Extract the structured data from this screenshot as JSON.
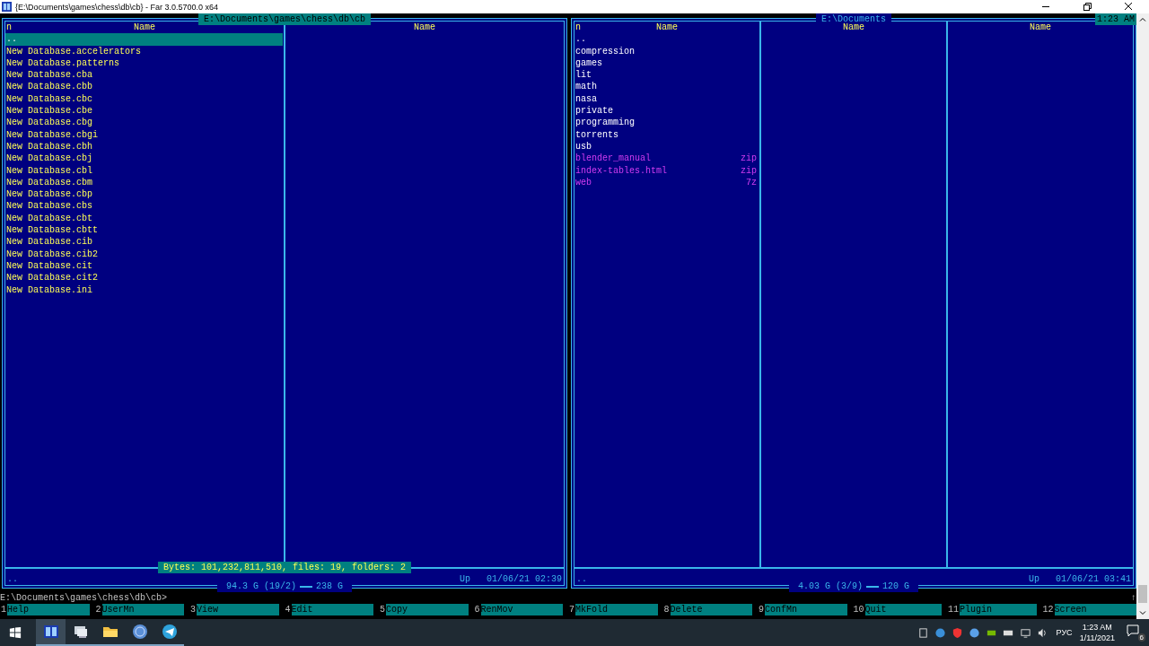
{
  "window": {
    "title": "{E:\\Documents\\games\\chess\\db\\cb} - Far 3.0.5700.0 x64"
  },
  "clock": "1:23 AM",
  "panels": [
    {
      "title": "E:\\Documents\\games\\chess\\db\\cb",
      "active": true,
      "sort_mark": "n",
      "column_headings": [
        "Name",
        "Name"
      ],
      "items": [
        {
          "name": "..",
          "kind": "up",
          "selected": true
        },
        {
          "name": "New Database.accelerators",
          "kind": "file",
          "selected": false
        },
        {
          "name": "New Database.patterns",
          "kind": "file",
          "selected": false
        },
        {
          "name": "New Database.cba",
          "kind": "file",
          "selected": false
        },
        {
          "name": "New Database.cbb",
          "kind": "file",
          "selected": false
        },
        {
          "name": "New Database.cbc",
          "kind": "file",
          "selected": false
        },
        {
          "name": "New Database.cbe",
          "kind": "file",
          "selected": false
        },
        {
          "name": "New Database.cbg",
          "kind": "file",
          "selected": false
        },
        {
          "name": "New Database.cbgi",
          "kind": "file",
          "selected": false
        },
        {
          "name": "New Database.cbh",
          "kind": "file",
          "selected": false
        },
        {
          "name": "New Database.cbj",
          "kind": "file",
          "selected": false
        },
        {
          "name": "New Database.cbl",
          "kind": "file",
          "selected": false
        },
        {
          "name": "New Database.cbm",
          "kind": "file",
          "selected": false
        },
        {
          "name": "New Database.cbp",
          "kind": "file",
          "selected": false
        },
        {
          "name": "New Database.cbs",
          "kind": "file",
          "selected": false
        },
        {
          "name": "New Database.cbt",
          "kind": "file",
          "selected": false
        },
        {
          "name": "New Database.cbtt",
          "kind": "file",
          "selected": false
        },
        {
          "name": "New Database.cib",
          "kind": "file",
          "selected": false
        },
        {
          "name": "New Database.cib2",
          "kind": "file",
          "selected": false
        },
        {
          "name": "New Database.cit",
          "kind": "file",
          "selected": false
        },
        {
          "name": "New Database.cit2",
          "kind": "file",
          "selected": false
        },
        {
          "name": "New Database.ini",
          "kind": "file",
          "selected": false
        }
      ],
      "selection_info": "Bytes: 101,232,811,510, files: 19, folders: 2",
      "status": {
        "name": "..",
        "info": "Up",
        "date": "01/06/21 02:39"
      },
      "totals": [
        "94.3 G (19/2)",
        "238 G"
      ]
    },
    {
      "title": "E:\\Documents",
      "active": false,
      "sort_mark": "n",
      "column_headings": [
        "Name",
        "Name",
        "Name"
      ],
      "items": [
        {
          "name": "..",
          "kind": "up",
          "selected": false
        },
        {
          "name": "compression",
          "kind": "folder",
          "selected": false
        },
        {
          "name": "games",
          "kind": "folder",
          "selected": false
        },
        {
          "name": "lit",
          "kind": "folder",
          "selected": false
        },
        {
          "name": "math",
          "kind": "folder",
          "selected": false
        },
        {
          "name": "nasa",
          "kind": "folder",
          "selected": false
        },
        {
          "name": "private",
          "kind": "folder",
          "selected": false
        },
        {
          "name": "programming",
          "kind": "folder",
          "selected": false
        },
        {
          "name": "torrents",
          "kind": "folder",
          "selected": false
        },
        {
          "name": "usb",
          "kind": "folder",
          "selected": false
        },
        {
          "name": "blender_manual",
          "ext": "zip",
          "kind": "archive",
          "selected": false
        },
        {
          "name": "index-tables.html",
          "ext": "zip",
          "kind": "archive",
          "selected": false
        },
        {
          "name": "web",
          "ext": "7z",
          "kind": "archive",
          "selected": false
        }
      ],
      "status": {
        "name": "..",
        "info": "Up",
        "date": "01/06/21 03:41"
      },
      "totals": [
        "4.03 G (3/9)",
        "120 G"
      ]
    }
  ],
  "command_line": {
    "prompt": "E:\\Documents\\games\\chess\\db\\cb>",
    "indicator": "↑"
  },
  "keybar": [
    {
      "key": "1",
      "label": "Help"
    },
    {
      "key": "2",
      "label": "UserMn"
    },
    {
      "key": "3",
      "label": "View"
    },
    {
      "key": "4",
      "label": "Edit"
    },
    {
      "key": "5",
      "label": "Copy"
    },
    {
      "key": "6",
      "label": "RenMov"
    },
    {
      "key": "7",
      "label": "MkFold"
    },
    {
      "key": "8",
      "label": "Delete"
    },
    {
      "key": "9",
      "label": "ConfMn"
    },
    {
      "key": "10",
      "label": "Quit"
    },
    {
      "key": "11",
      "label": "Plugin"
    },
    {
      "key": "12",
      "label": "Screen"
    }
  ],
  "taskbar": {
    "apps": [
      {
        "kind": "console",
        "selected": true
      },
      {
        "kind": "computer",
        "selected": false
      },
      {
        "kind": "folder",
        "selected": false
      },
      {
        "kind": "disc",
        "selected": false
      },
      {
        "kind": "plane",
        "selected": false
      }
    ],
    "language": "РУС",
    "time": "1:23 AM",
    "date": "1/11/2021",
    "notifications": "6"
  }
}
